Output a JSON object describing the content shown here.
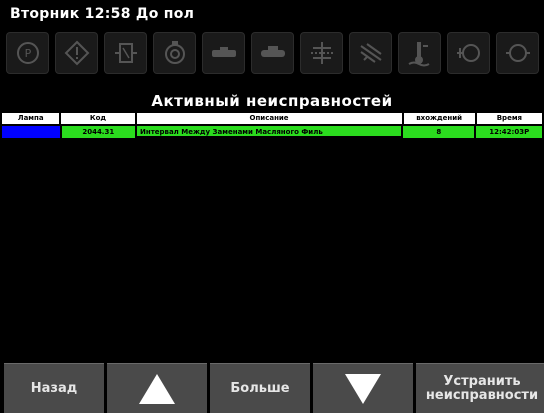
{
  "header": {
    "title": "Вторник 12:58 До пол"
  },
  "icons": [
    "parking-brake-icon",
    "warning-icon",
    "fuel-filter-icon",
    "oil-filter-icon",
    "engine-icon",
    "engine-2-icon",
    "cooling-icon",
    "air-filter-icon",
    "coolant-temp-icon",
    "engine-check-icon",
    "engine-3-icon"
  ],
  "section": {
    "title": "Активный неисправностей"
  },
  "table": {
    "headers": [
      "Лампа",
      "Код",
      "Описание",
      "вхождений",
      "Время"
    ],
    "rows": [
      {
        "lamp": "",
        "code": "2044.31",
        "description": "Интервал Между Заменами Масляного Филь",
        "occurrences": "8",
        "time": "12:42:03P"
      }
    ]
  },
  "buttons": {
    "back": "Назад",
    "more": "Больше",
    "fix_line1": "Устранить",
    "fix_line2": "неисправности"
  },
  "colors": {
    "row_green": "#2bdc1e",
    "lamp_blue": "#0000ff",
    "button_bg": "#4a4a4a"
  }
}
